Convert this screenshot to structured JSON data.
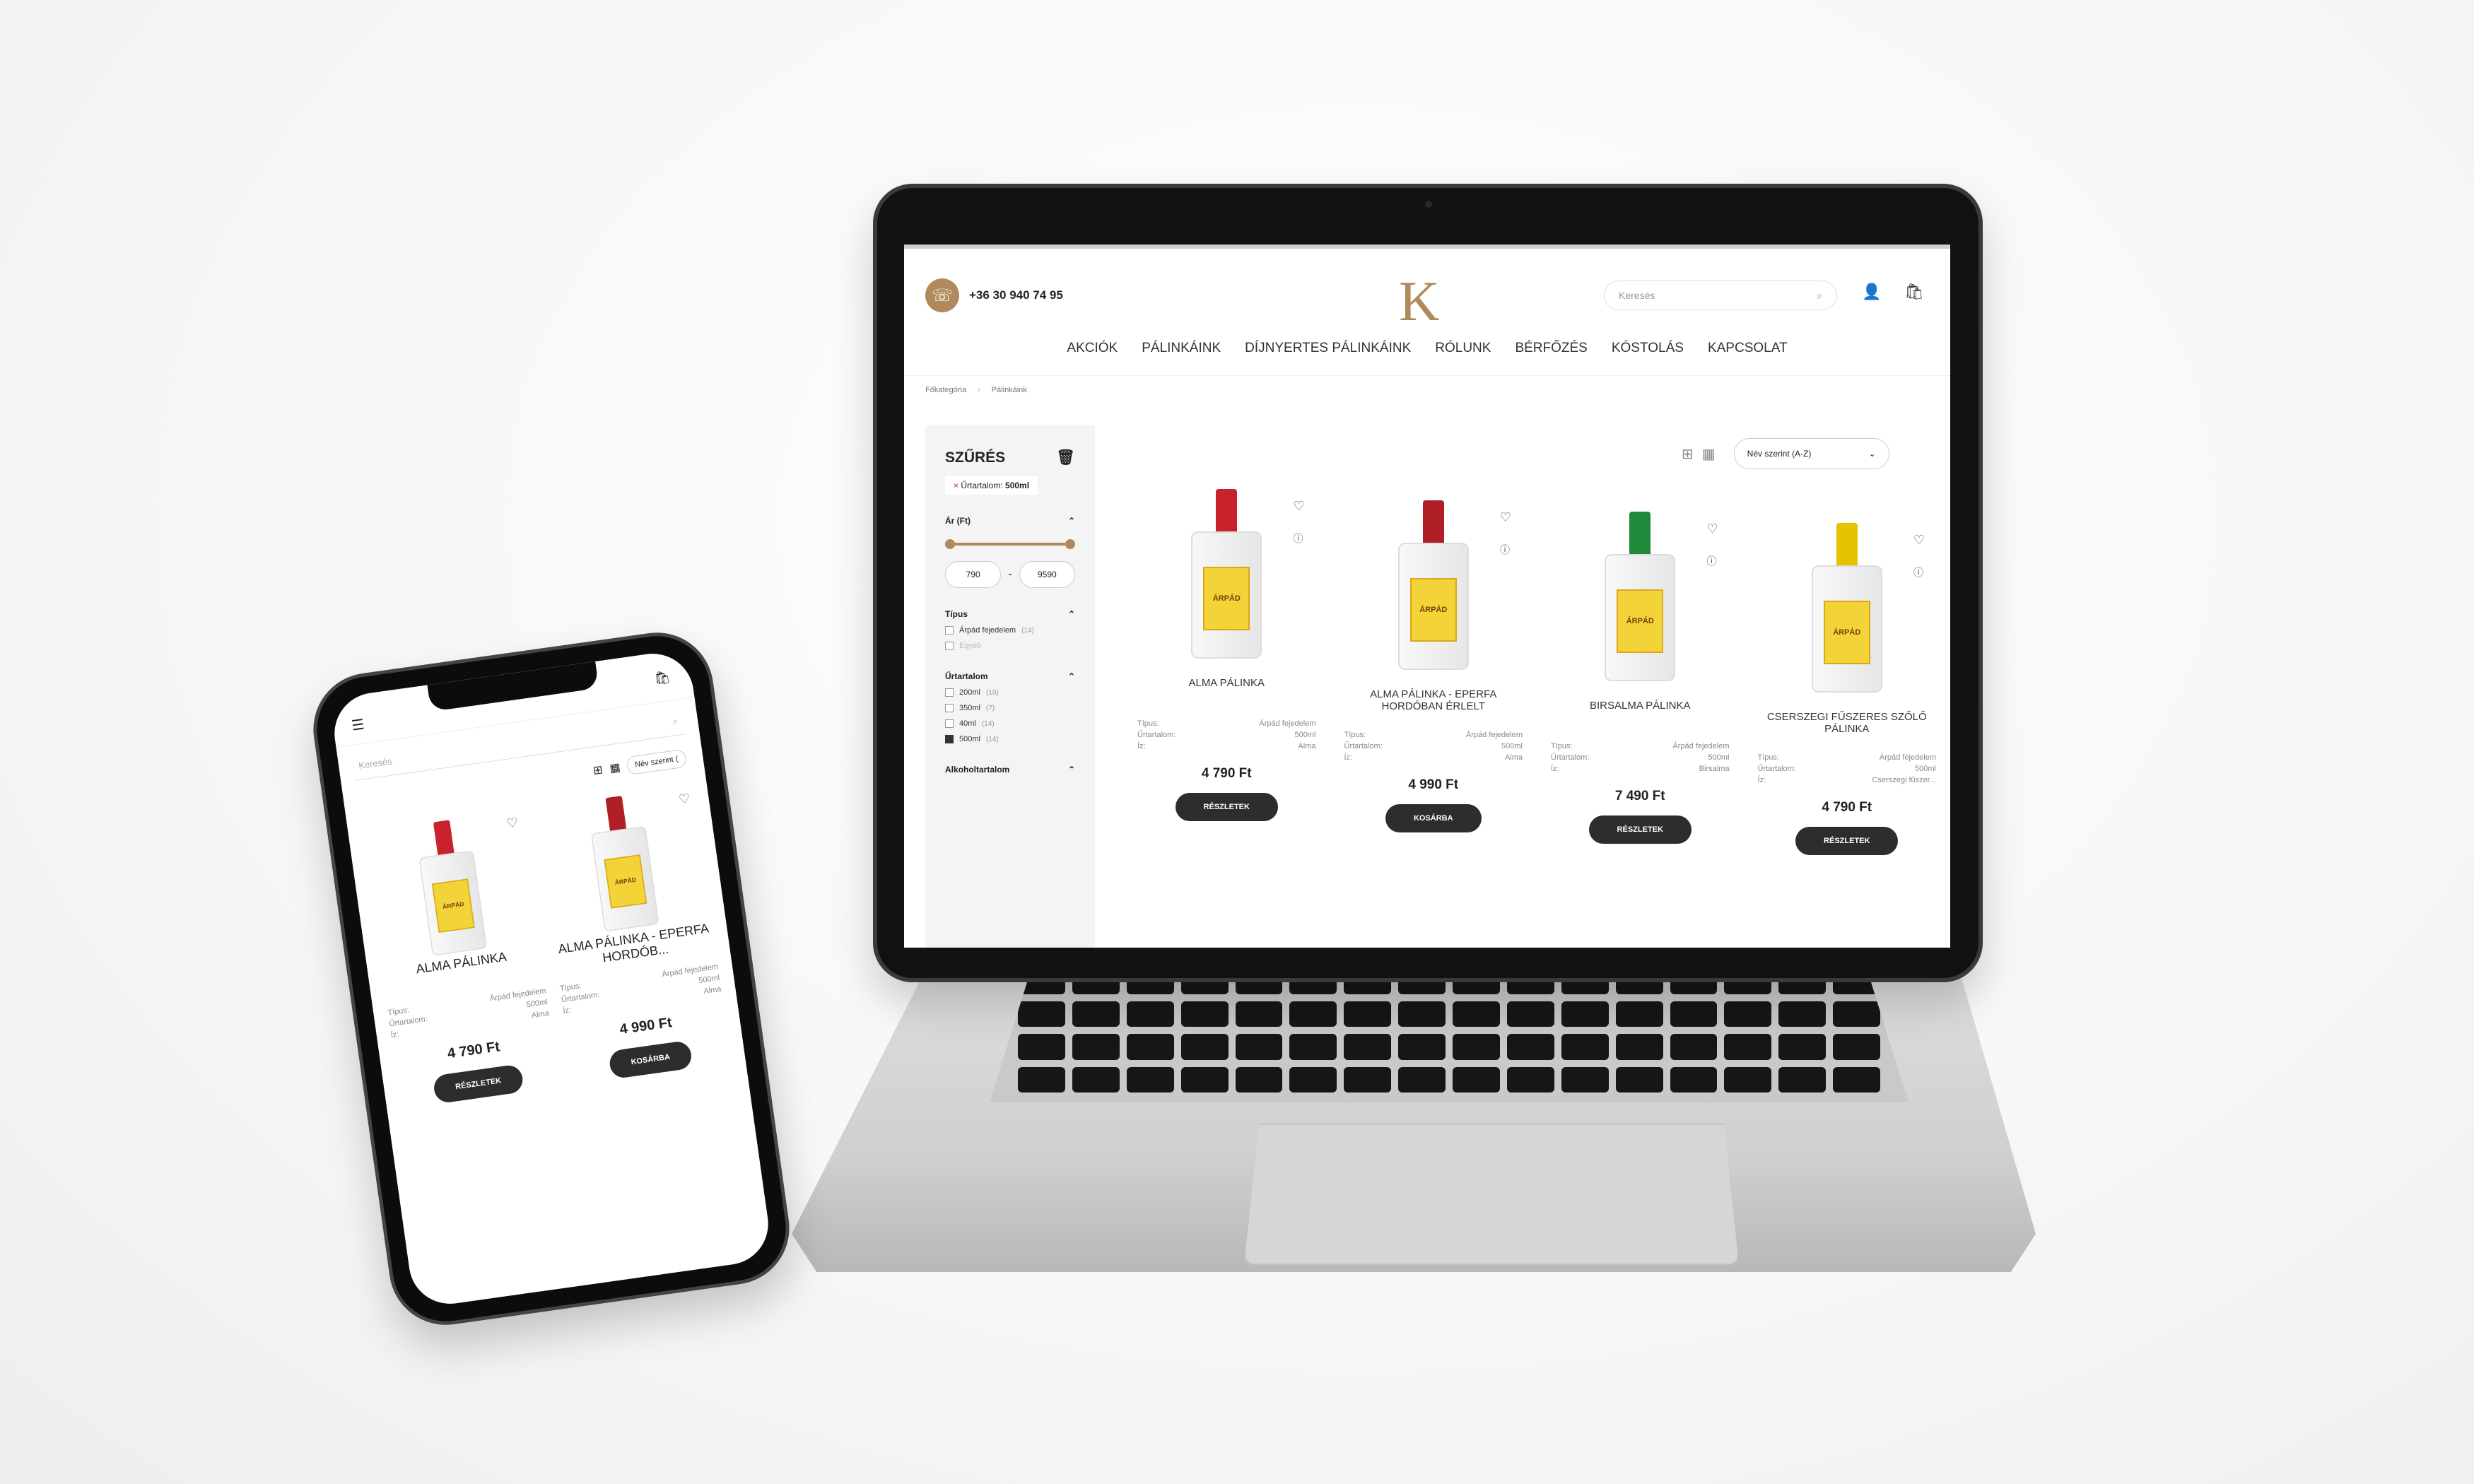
{
  "header": {
    "phone": "+36 30 940 74 95",
    "logo_letter": "K",
    "search_placeholder": "Keresés",
    "nav": [
      "AKCIÓK",
      "PÁLINKÁINK",
      "DÍJNYERTES PÁLINKÁINK",
      "RÓLUNK",
      "BÉRFŐZÉS",
      "KÓSTOLÁS",
      "KAPCSOLAT"
    ]
  },
  "breadcrumb": [
    "Főkategória",
    "Pálinkáink"
  ],
  "filter": {
    "title": "SZŰRÉS",
    "active_chip_label": "Űrtartalom:",
    "active_chip_value": "500ml",
    "price_label": "Ár (Ft)",
    "price_min": "790",
    "price_max": "9590",
    "type_label": "Típus",
    "types": [
      {
        "label": "Árpád fejedelem",
        "count": "(14)"
      },
      {
        "label": "Egyéb",
        "count": ""
      }
    ],
    "volume_label": "Űrtartalom",
    "volumes": [
      {
        "label": "200ml",
        "count": "(10)",
        "checked": false
      },
      {
        "label": "350ml",
        "count": "(7)",
        "checked": false
      },
      {
        "label": "40ml",
        "count": "(14)",
        "checked": false
      },
      {
        "label": "500ml",
        "count": "(14)",
        "checked": true
      }
    ],
    "alcohol_label": "Alkoholtartalom"
  },
  "sort_label": "Név szerint (A-Z)",
  "spec_labels": {
    "type": "Típus:",
    "volume": "Űrtartalom:",
    "taste": "Íz:"
  },
  "products": [
    {
      "name": "ALMA PÁLINKA",
      "type": "Árpád fejedelem",
      "volume": "500ml",
      "taste": "Alma",
      "price": "4 790 Ft",
      "button": "RÉSZLETEK",
      "cap": "#c8232c",
      "label_text": "ÁRPÁD"
    },
    {
      "name": "ALMA PÁLINKA - EPERFA HORDÓBAN ÉRLELT",
      "type": "Árpád fejedelem",
      "volume": "500ml",
      "taste": "Alma",
      "price": "4 990 Ft",
      "button": "KOSÁRBA",
      "cap": "#b01e26",
      "label_text": "ÁRPÁD"
    },
    {
      "name": "BIRSALMA PÁLINKA",
      "type": "Árpád fejedelem",
      "volume": "500ml",
      "taste": "Birsalma",
      "price": "7 490 Ft",
      "button": "RÉSZLETEK",
      "cap": "#1f8a3a",
      "label_text": "ÁRPÁD"
    },
    {
      "name": "CSERSZEGI FŰSZERES SZŐLŐ PÁLINKA",
      "type": "Árpád fejedelem",
      "volume": "500ml",
      "taste": "Cserszegi fűszer...",
      "price": "4 790 Ft",
      "button": "RÉSZLETEK",
      "cap": "#e7c200",
      "label_text": "ÁRPÁD"
    }
  ],
  "mobile": {
    "search_placeholder": "Keresés",
    "sort_label": "Név szerint (",
    "products": [
      {
        "name": "ALMA PÁLINKA",
        "type": "Árpád fejedelem",
        "volume": "500ml",
        "taste": "Alma",
        "price": "4 790 Ft",
        "button": "RÉSZLETEK"
      },
      {
        "name": "ALMA PÁLINKA - EPERFA HORDÓB...",
        "type": "Árpád fejedelem",
        "volume": "500ml",
        "taste": "Alma",
        "price": "4 990 Ft",
        "button": "KOSÁRBA"
      }
    ]
  }
}
